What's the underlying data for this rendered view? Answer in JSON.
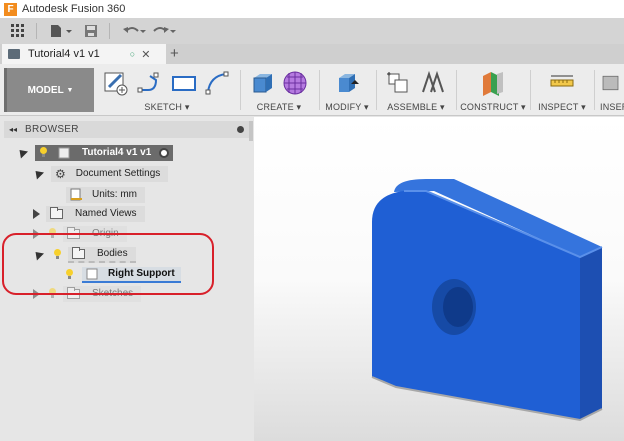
{
  "app": {
    "title": "Autodesk Fusion 360",
    "logo_letter": "F"
  },
  "quick_access": {
    "icons": [
      "grid-icon",
      "file-icon",
      "save-icon",
      "undo-icon",
      "redo-icon"
    ]
  },
  "tab": {
    "label": "Tutorial4 v1 v1"
  },
  "ribbon": {
    "workspace_label": "MODEL",
    "groups": [
      {
        "label": "SKETCH"
      },
      {
        "label": "CREATE"
      },
      {
        "label": "MODIFY"
      },
      {
        "label": "ASSEMBLE"
      },
      {
        "label": "CONSTRUCT"
      },
      {
        "label": "INSPECT"
      },
      {
        "label": "INSER"
      }
    ]
  },
  "browser": {
    "title": "BROWSER",
    "root": "Tutorial4 v1 v1",
    "document_settings": "Document Settings",
    "units": "Units: mm",
    "named_views": "Named Views",
    "origin": "Origin",
    "bodies": "Bodies",
    "body_item": "Right Support",
    "sketches": "Sketches"
  },
  "colors": {
    "accent_annotation": "#d8202a",
    "body_color": "#1f5fd4"
  }
}
